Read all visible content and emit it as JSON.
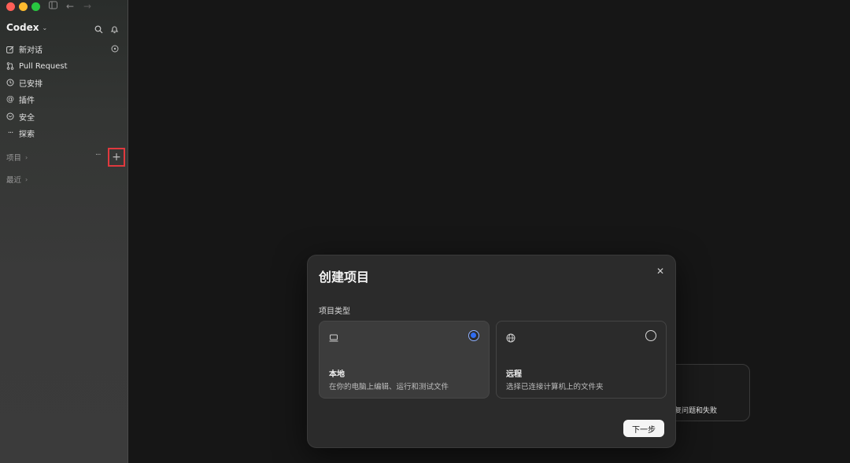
{
  "app": {
    "title": "Codex"
  },
  "sidebar": {
    "items": [
      {
        "label": "新对话",
        "icon": "edit-icon"
      },
      {
        "label": "Pull Request",
        "icon": "pull-request-icon"
      },
      {
        "label": "已安排",
        "icon": "clock-icon"
      },
      {
        "label": "插件",
        "icon": "at-icon"
      },
      {
        "label": "安全",
        "icon": "shield-icon"
      },
      {
        "label": "探索",
        "icon": "more-dots-icon"
      }
    ],
    "sections": {
      "projects": "项目",
      "recent": "最近"
    }
  },
  "background": {
    "card_text": "复问题和失败"
  },
  "modal": {
    "title": "创建项目",
    "field_label": "项目类型",
    "options": [
      {
        "title": "本地",
        "description": "在你的电脑上编辑、运行和测试文件",
        "selected": true
      },
      {
        "title": "远程",
        "description": "选择已连接计算机上的文件夹",
        "selected": false
      }
    ],
    "next_label": "下一步"
  },
  "colors": {
    "accent_radio": "#2f6cf2",
    "highlight_box": "#e0393e",
    "main_background": "#161616"
  }
}
